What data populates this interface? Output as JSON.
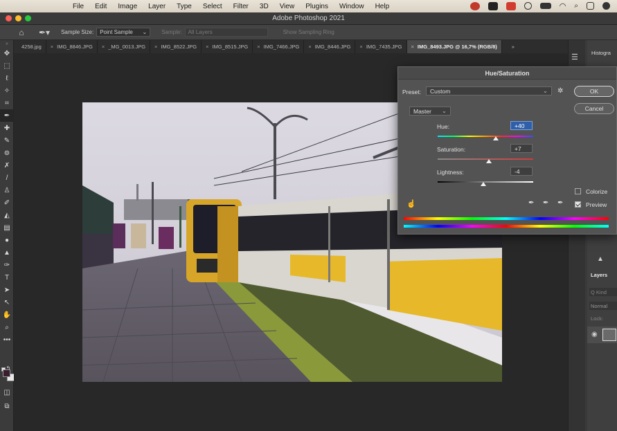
{
  "menubar": {
    "items": [
      "File",
      "Edit",
      "Image",
      "Layer",
      "Type",
      "Select",
      "Filter",
      "3D",
      "View",
      "Plugins",
      "Window",
      "Help"
    ]
  },
  "window": {
    "title": "Adobe Photoshop 2021"
  },
  "options": {
    "sample_size_label": "Sample Size:",
    "sample_size_value": "Point Sample",
    "sample_label": "Sample:",
    "sample_value": "All Layers",
    "show_ring_label": "Show Sampling Ring"
  },
  "tabs": [
    {
      "label": "4258.jpg",
      "close": ""
    },
    {
      "label": "IMG_8846.JPG",
      "close": "×"
    },
    {
      "label": "_MG_0013.JPG",
      "close": "×"
    },
    {
      "label": "IMG_8522.JPG",
      "close": "×"
    },
    {
      "label": "IMG_8515.JPG",
      "close": "×"
    },
    {
      "label": "IMG_7466.JPG",
      "close": "×"
    },
    {
      "label": "IMG_8446.JPG",
      "close": "×"
    },
    {
      "label": "IMG_7435.JPG",
      "close": "×"
    },
    {
      "label": "IMG_8493.JPG @ 16,7% (RGB/8)",
      "close": "×"
    }
  ],
  "tab_overflow": "»",
  "right_panel": {
    "histogram_label": "Histogra",
    "layers_label": "Layers",
    "kind_placeholder": "Q Kind",
    "blend_mode": "Normal",
    "lock_label": "Lock:"
  },
  "dialog": {
    "title": "Hue/Saturation",
    "preset_label": "Preset:",
    "preset_value": "Custom",
    "ok_label": "OK",
    "cancel_label": "Cancel",
    "channel": "Master",
    "hue_label": "Hue:",
    "hue_value": "+40",
    "saturation_label": "Saturation:",
    "saturation_value": "+7",
    "lightness_label": "Lightness:",
    "lightness_value": "-4",
    "colorize_label": "Colorize",
    "colorize_checked": false,
    "preview_label": "Preview",
    "preview_checked": true
  }
}
